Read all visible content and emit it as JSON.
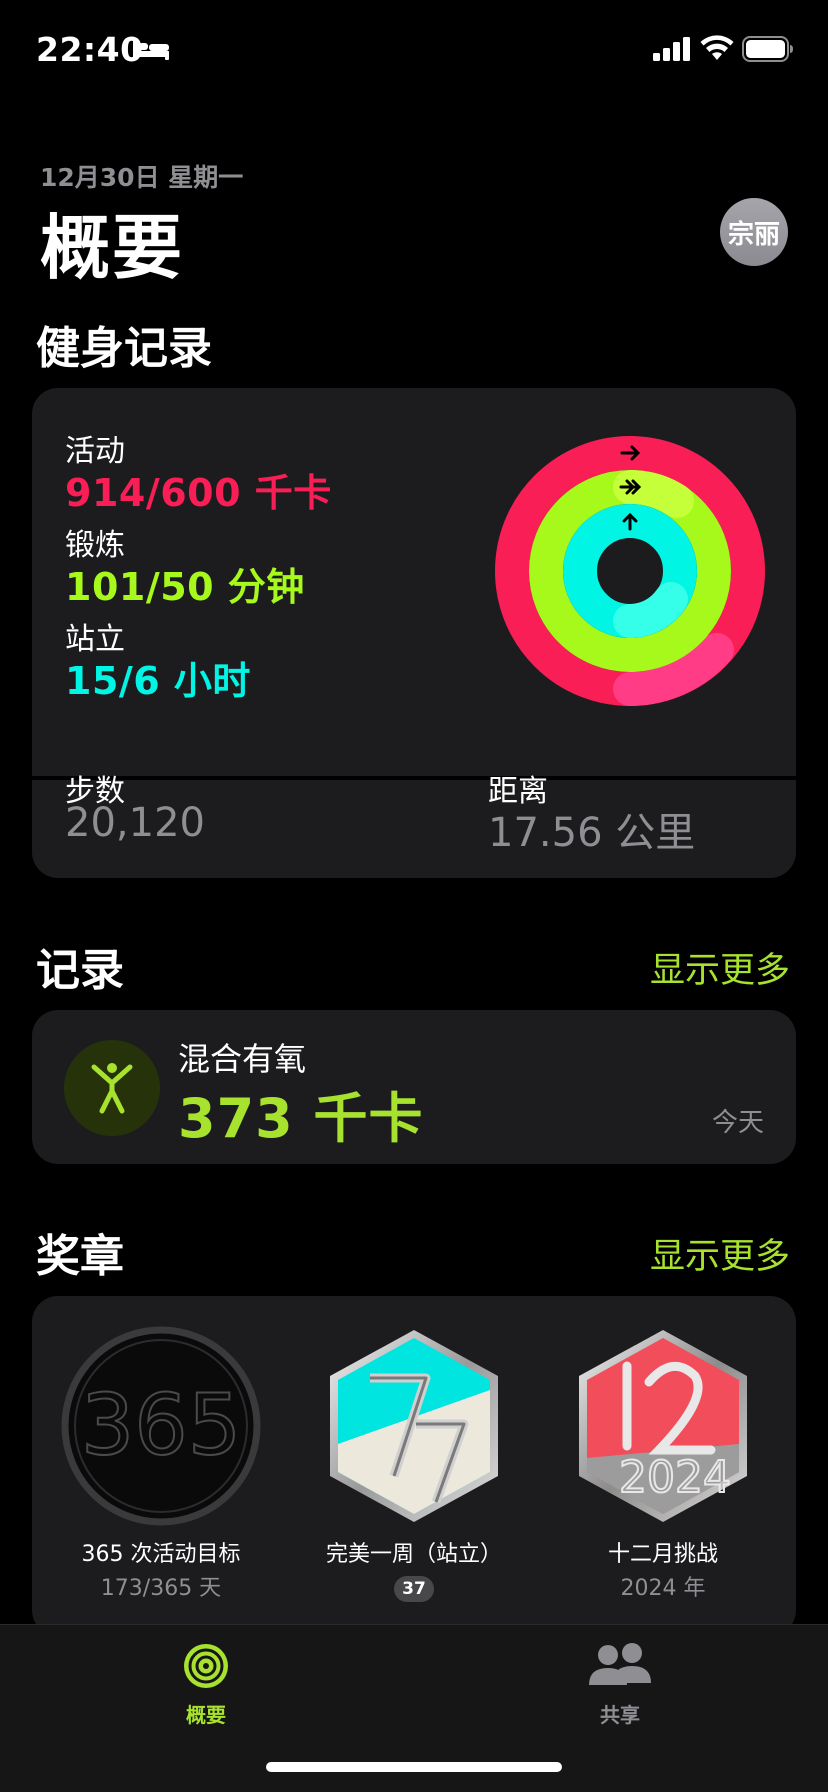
{
  "status_bar": {
    "time": "22:40",
    "icons": [
      "bed-icon",
      "signal-icon",
      "wifi-icon",
      "battery-icon"
    ]
  },
  "header": {
    "date": "12月30日 星期一",
    "title": "概要",
    "avatar_text": "宗丽"
  },
  "fitness": {
    "section_title": "健身记录",
    "move": {
      "label": "活动",
      "value": "914/600 千卡",
      "color": "#fa1e56",
      "progress": 1.52
    },
    "exercise": {
      "label": "锻炼",
      "value": "101/50 分钟",
      "color": "#a7f91c",
      "progress": 2.02
    },
    "stand": {
      "label": "站立",
      "value": "15/6 小时",
      "color": "#00f5e4",
      "progress": 2.5
    },
    "steps": {
      "label": "步数",
      "value": "20,120"
    },
    "distance": {
      "label": "距离",
      "value": "17.56 公里"
    }
  },
  "records": {
    "section_title": "记录",
    "show_more": "显示更多",
    "item": {
      "icon": "person-arms-raised-icon",
      "name": "混合有氧",
      "value": "373 千卡",
      "date": "今天"
    }
  },
  "awards": {
    "section_title": "奖章",
    "show_more": "显示更多",
    "items": [
      {
        "name": "365 次活动目标",
        "sub": "173/365 天",
        "icon": "365-award-icon"
      },
      {
        "name": "完美一周（站立）",
        "badge": "37",
        "icon": "perfect-week-award-icon"
      },
      {
        "name": "十二月挑战",
        "sub": "2024 年",
        "icon": "december-challenge-award-icon"
      }
    ]
  },
  "tab_bar": {
    "tabs": [
      {
        "label": "概要",
        "active": true,
        "icon": "activity-rings-icon"
      },
      {
        "label": "共享",
        "active": false,
        "icon": "people-icon"
      }
    ],
    "active_color": "#a7e22e",
    "inactive_color": "#8e8e93"
  }
}
